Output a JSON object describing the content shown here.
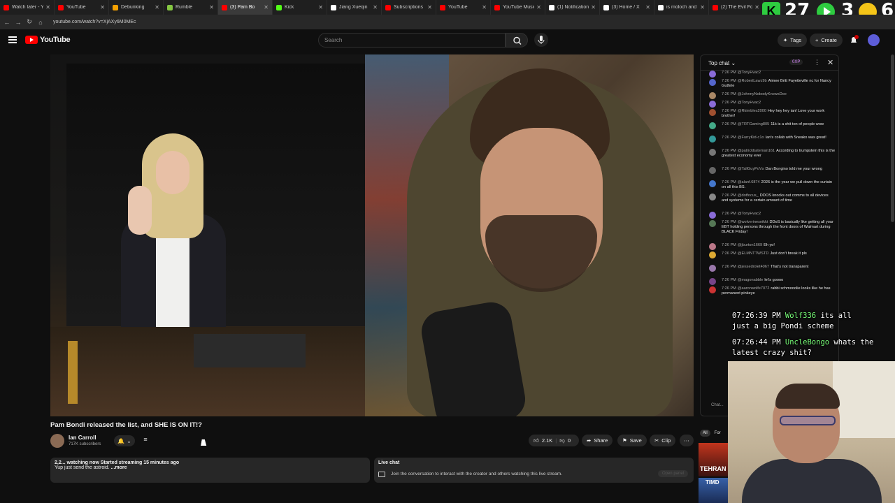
{
  "browser": {
    "tabs": [
      {
        "label": "Watch later - Yo",
        "color": "#ff0000"
      },
      {
        "label": "YouTube",
        "color": "#ff0000"
      },
      {
        "label": "Debunking",
        "color": "#f4a000"
      },
      {
        "label": "Rumble",
        "color": "#85c742"
      },
      {
        "label": "(3) Pam Bo",
        "color": "#ff0000",
        "active": true
      },
      {
        "label": "Kick",
        "color": "#53fc18"
      },
      {
        "label": "Jiang Xueqin",
        "color": "#ffffff"
      },
      {
        "label": "Subscriptions",
        "color": "#ff0000"
      },
      {
        "label": "YouTube",
        "color": "#ff0000"
      },
      {
        "label": "YouTube Music",
        "color": "#ff0000"
      },
      {
        "label": "(1) Notification",
        "color": "#ffffff"
      },
      {
        "label": "(3) Home / X",
        "color": "#ffffff"
      },
      {
        "label": "is moloch and",
        "color": "#ffffff"
      },
      {
        "label": "(2) The Evil Fore",
        "color": "#ff0000"
      }
    ],
    "url": "youtube.com/watch?v=XjAXy6M0MEc"
  },
  "stream_overlay": {
    "num1": "27",
    "num2": "3",
    "num3": "6"
  },
  "header": {
    "logo_text": "YouTube",
    "search_placeholder": "Search",
    "tags_label": "Tags",
    "create_label": "Create",
    "bell_badge": "2"
  },
  "video": {
    "title": "Pam Bondi released the list, and SHE IS ON IT!?",
    "channel_name": "Ian Carroll",
    "channel_subs": "717K subscribers",
    "like_count": "2.1K",
    "dislike_count": "0",
    "share_label": "Share",
    "save_label": "Save",
    "clip_label": "Clip"
  },
  "description": {
    "line1": "2,2... watching now  Started streaming 15 minutes ago",
    "line2": "Yup just send the astroid.",
    "more": "...more"
  },
  "live_chat_card": {
    "title": "Live chat",
    "text": "Join the conversation to interact with the creator and others watching this live stream.",
    "open_button": "Open panel"
  },
  "chat": {
    "header": "Top chat",
    "xp_badge": "0XP",
    "input_placeholder": "Chat...",
    "messages": [
      {
        "time": "7:26 PM",
        "name": "@TonyHvac2",
        "text": "",
        "color": "#8a6bd8"
      },
      {
        "time": "7:26 PM",
        "name": "@RobertLawz9b",
        "text": "Aimee Britt Fayetteville nc for Nancy Guthrie",
        "color": "#5566cc"
      },
      {
        "time": "7:26 PM",
        "name": "@JohnnyNobodyKnowsDoe",
        "text": "",
        "color": "#aa8866"
      },
      {
        "time": "7:26 PM",
        "name": "@TonyHvac2",
        "text": "",
        "color": "#8a6bd8"
      },
      {
        "time": "7:26 PM",
        "name": "@Rkimbles2000",
        "text": "Hey hey hey ian! Love your work brother!",
        "color": "#a05030"
      },
      {
        "time": "7:26 PM",
        "name": "@TRTGaming805",
        "text": "11k is a shit ton of people wow",
        "color": "#44aa88"
      },
      {
        "time": "7:26 PM",
        "name": "@FurryKid-c1o",
        "text": "Ian's collab with Sneako was great!",
        "color": "#339999"
      },
      {
        "time": "7:26 PM",
        "name": "@patrickbateman161",
        "text": "According to trumpstein this is the greatest economy ever",
        "color": "#777777"
      },
      {
        "time": "7:26 PM",
        "name": "@TallGuyPoVs",
        "text": "Dan Bongino told me your wrong",
        "color": "#666666"
      },
      {
        "time": "7:26 PM",
        "name": "@alanf.6874",
        "text": "2026 is the year we pull down the curtain on all this BS.",
        "color": "#4477cc"
      },
      {
        "time": "7:26 PM",
        "name": "@dotfocus_",
        "text": "DDOS knocks out comms to all devices and systems for a certain amount of time",
        "color": "#888888"
      },
      {
        "time": "7:26 PM",
        "name": "@TonyHvac2",
        "text": "",
        "color": "#8a6bd8"
      },
      {
        "time": "7:26 PM",
        "name": "@wolverinesnikkt",
        "text": "DDoS is basically like getting all your EBT holding persons through the front doors of Walmart during BLACK Friday!",
        "color": "#557755"
      },
      {
        "time": "7:26 PM",
        "name": "@jburton1669",
        "text": "Eh yo!",
        "color": "#bb7788"
      },
      {
        "time": "7:26 PM",
        "name": "@ELMNTTWSTD",
        "text": "Just don't break it pls",
        "color": "#ddaa33"
      },
      {
        "time": "7:26 PM",
        "name": "@jessedrolet4067",
        "text": "That's not transparent",
        "color": "#9977aa"
      },
      {
        "time": "7:26 PM",
        "name": "@magonabble",
        "text": "let's goooo",
        "color": "#774488"
      },
      {
        "time": "7:26 PM",
        "name": "@aaronwolfe7072",
        "text": "rabbi schmooolie looks like he has permanent pinkeye",
        "color": "#cc3333"
      }
    ]
  },
  "overlay_chat": [
    {
      "time": "07:26:39 PM",
      "user": "Wolf336",
      "text": "its all",
      "cont": "just a big Pondi scheme"
    },
    {
      "time": "07:26:44 PM",
      "user": "UncleBongo",
      "text": "whats the",
      "cont": "latest crazy shit?"
    }
  ],
  "sidebar_bottom": {
    "chip_all": "All",
    "chip_for": "For",
    "thumb1_text": "TEHRAN",
    "thumb2_text": "TIMD"
  }
}
